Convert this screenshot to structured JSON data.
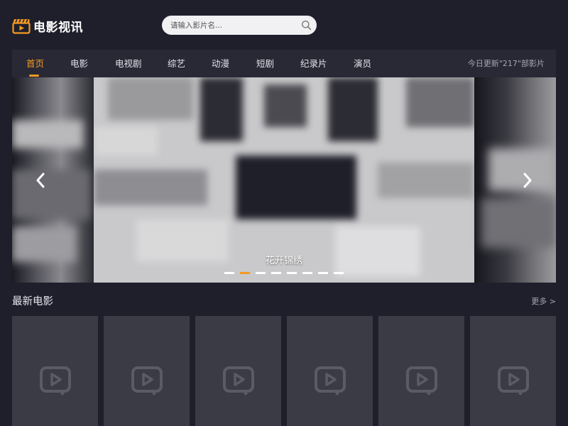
{
  "header": {
    "logo_text": "电影视讯",
    "search_placeholder": "请输入影片名..."
  },
  "nav": {
    "items": [
      {
        "label": "首页",
        "active": true
      },
      {
        "label": "电影",
        "active": false
      },
      {
        "label": "电视剧",
        "active": false
      },
      {
        "label": "综艺",
        "active": false
      },
      {
        "label": "动漫",
        "active": false
      },
      {
        "label": "短剧",
        "active": false
      },
      {
        "label": "纪录片",
        "active": false
      },
      {
        "label": "演员",
        "active": false
      }
    ],
    "update_text": "今日更新\"217\"部影片"
  },
  "banner": {
    "slide_title": "花开锦绣",
    "slide_count": 8,
    "active_slide_index": 1
  },
  "section": {
    "title": "最新电影",
    "more_label": "更多 >",
    "card_count": 6
  },
  "colors": {
    "accent": "#f49a21",
    "background": "#1f1f2c",
    "nav_bg": "#292936",
    "card_bg": "#3b3b46"
  }
}
